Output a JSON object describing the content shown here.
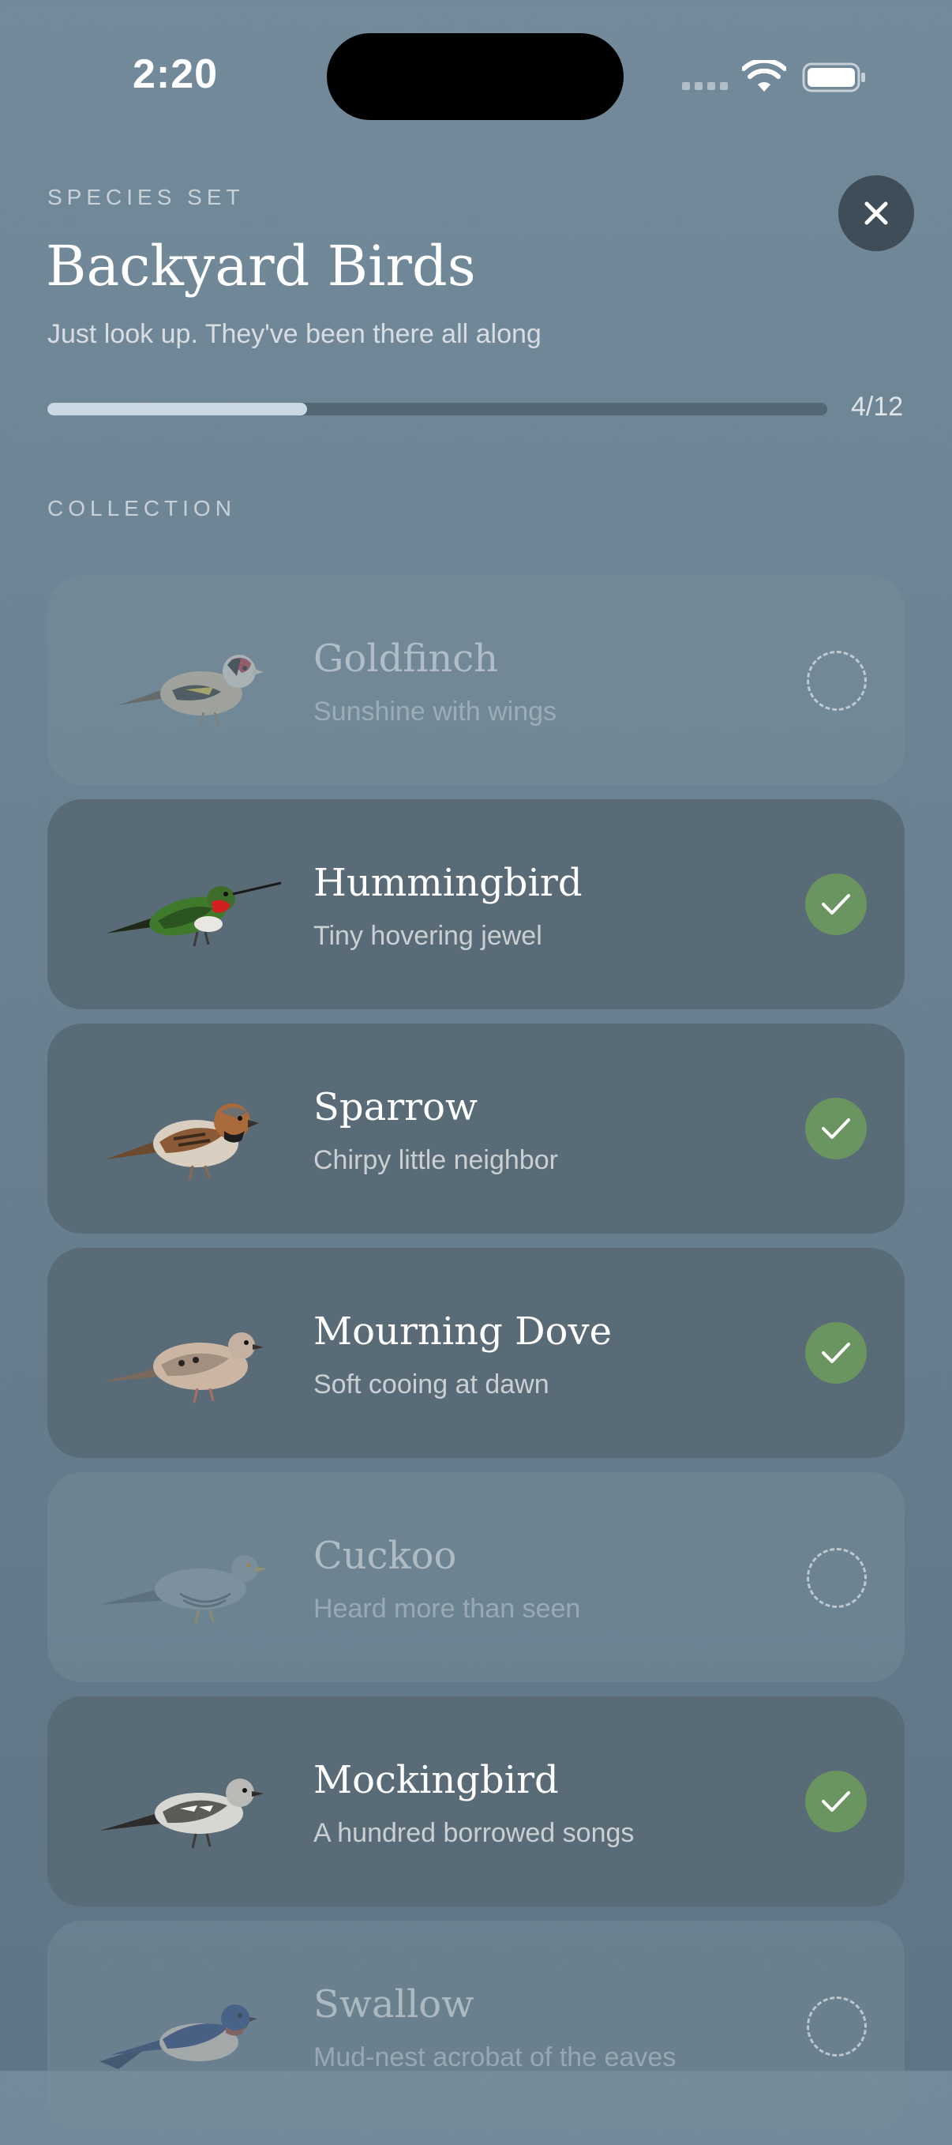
{
  "status_bar": {
    "time": "2:20"
  },
  "header": {
    "eyebrow": "SPECIES SET",
    "title": "Backyard Birds",
    "subtitle": "Just look up. They've been there all along"
  },
  "progress": {
    "collected": 4,
    "total": 12,
    "fraction": 0.3333,
    "label": "4/12"
  },
  "section": {
    "label": "COLLECTION"
  },
  "birds": [
    {
      "name": "Goldfinch",
      "tagline": "Sunshine with wings",
      "collected": false,
      "icon": "goldfinch-illustration"
    },
    {
      "name": "Hummingbird",
      "tagline": "Tiny hovering jewel",
      "collected": true,
      "icon": "hummingbird-illustration"
    },
    {
      "name": "Sparrow",
      "tagline": "Chirpy little neighbor",
      "collected": true,
      "icon": "sparrow-illustration"
    },
    {
      "name": "Mourning Dove",
      "tagline": "Soft cooing at dawn",
      "collected": true,
      "icon": "mourning-dove-illustration"
    },
    {
      "name": "Cuckoo",
      "tagline": "Heard more than seen",
      "collected": false,
      "icon": "cuckoo-illustration"
    },
    {
      "name": "Mockingbird",
      "tagline": "A hundred borrowed songs",
      "collected": true,
      "icon": "mockingbird-illustration"
    },
    {
      "name": "Swallow",
      "tagline": "Mud-nest acrobat of the eaves",
      "collected": false,
      "icon": "swallow-illustration"
    }
  ],
  "colors": {
    "collected_badge": "#6a9460",
    "card_collected": "#586b77",
    "close_button": "#3e4d57",
    "progress_fill": "#c9d8e2"
  }
}
